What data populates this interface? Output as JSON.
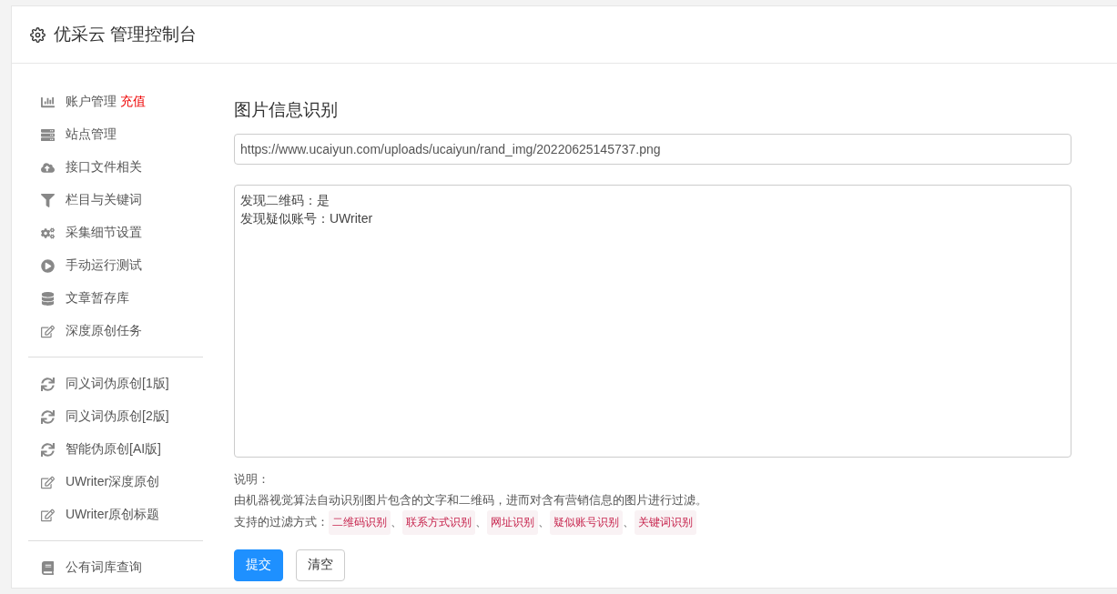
{
  "header": {
    "title": "优采云 管理控制台"
  },
  "sidebar": {
    "groups": [
      {
        "items": [
          {
            "kind": "chart",
            "label": "账户管理",
            "badge": "充值"
          },
          {
            "kind": "server",
            "label": "站点管理"
          },
          {
            "kind": "cloud",
            "label": "接口文件相关"
          },
          {
            "kind": "filter",
            "label": "栏目与关键词"
          },
          {
            "kind": "gears",
            "label": "采集细节设置"
          },
          {
            "kind": "play",
            "label": "手动运行测试"
          },
          {
            "kind": "database",
            "label": "文章暂存库"
          },
          {
            "kind": "edit",
            "label": "深度原创任务"
          }
        ]
      },
      {
        "items": [
          {
            "kind": "refresh",
            "label": "同义词伪原创[1版]"
          },
          {
            "kind": "refresh",
            "label": "同义词伪原创[2版]"
          },
          {
            "kind": "refresh",
            "label": "智能伪原创[AI版]"
          },
          {
            "kind": "edit",
            "label": "UWriter深度原创"
          },
          {
            "kind": "edit",
            "label": "UWriter原创标题"
          }
        ]
      },
      {
        "items": [
          {
            "kind": "book",
            "label": "公有词库查询"
          }
        ]
      }
    ]
  },
  "main": {
    "title": "图片信息识别",
    "url_field": {
      "value": "https://www.ucaiyun.com/uploads/ucaiyun/rand_img/20220625145737.png"
    },
    "result_box": {
      "lines": [
        "发现二维码：是",
        "发现疑似账号：UWriter"
      ]
    },
    "notes": {
      "heading": "说明：",
      "description": "由机器视觉算法自动识别图片包含的文字和二维码，进而对含有营销信息的图片进行过滤。",
      "methods_label": "支持的过滤方式：",
      "separator": "、",
      "methods": [
        "二维码识别",
        "联系方式识别",
        "网址识别",
        "疑似账号识别",
        "关键词识别"
      ]
    },
    "buttons": [
      {
        "kind": "primary",
        "label": "提交"
      },
      {
        "kind": "default",
        "label": "清空"
      }
    ]
  }
}
